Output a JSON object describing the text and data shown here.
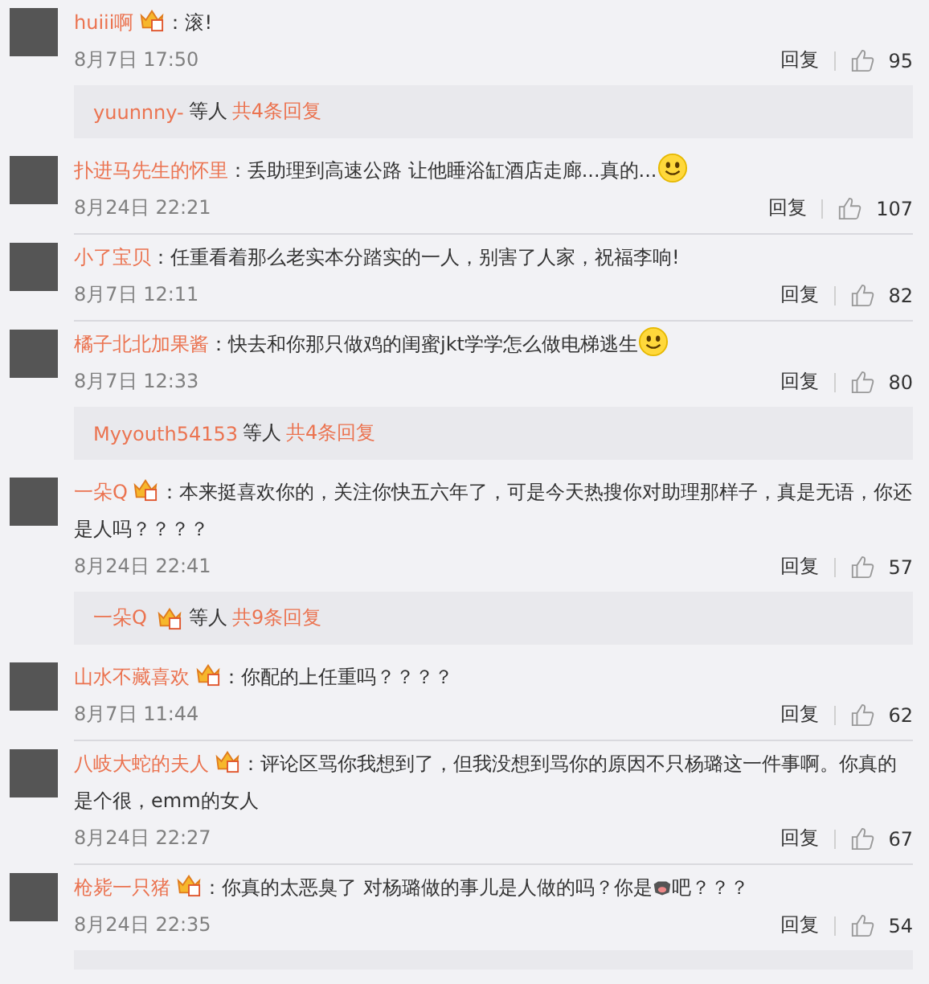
{
  "comments": [
    {
      "name": "huiii啊",
      "vip": true,
      "colon": "：",
      "parts": [
        {
          "kind": "text",
          "text": "滚!"
        }
      ],
      "date": "8月7日 17:50",
      "reply": "回复",
      "likes": "95",
      "thread": {
        "name": "yuunnny-",
        "vip": false,
        "suffix": "等人",
        "count": "共4条回复"
      }
    },
    {
      "name": "扑进马先生的怀里",
      "vip": false,
      "colon": "：",
      "parts": [
        {
          "kind": "text",
          "text": "丢助理到高速公路 让他睡浴缸酒店走廊...真的..."
        },
        {
          "kind": "smiley"
        }
      ],
      "date": "8月24日 22:21",
      "reply": "回复",
      "likes": "107"
    },
    {
      "name": "小了宝贝",
      "vip": false,
      "colon": "：",
      "parts": [
        {
          "kind": "text",
          "text": "任重看着那么老实本分踏实的一人，别害了人家，祝福李响!"
        }
      ],
      "date": "8月7日 12:11",
      "reply": "回复",
      "likes": "82"
    },
    {
      "name": "橘子北北加果酱",
      "vip": false,
      "colon": "：",
      "parts": [
        {
          "kind": "text",
          "text": "快去和你那只做鸡的闺蜜jkt学学怎么做电梯逃生"
        },
        {
          "kind": "smiley"
        }
      ],
      "date": "8月7日 12:33",
      "reply": "回复",
      "likes": "80",
      "thread": {
        "name": "Myyouth54153",
        "vip": false,
        "suffix": "等人",
        "count": "共4条回复"
      }
    },
    {
      "name": "一朵Q",
      "vip": true,
      "colon": "：",
      "parts": [
        {
          "kind": "text",
          "text": "本来挺喜欢你的，关注你快五六年了，可是今天热搜你对助理那样子，真是无语，你还是人吗？？？？"
        }
      ],
      "date": "8月24日 22:41",
      "reply": "回复",
      "likes": "57",
      "thread": {
        "name": "一朵Q",
        "vip": true,
        "suffix": "等人",
        "count": "共9条回复"
      }
    },
    {
      "name": "山水不藏喜欢",
      "vip": true,
      "colon": "：",
      "parts": [
        {
          "kind": "text",
          "text": "你配的上任重吗？？？？"
        }
      ],
      "date": "8月7日 11:44",
      "reply": "回复",
      "likes": "62"
    },
    {
      "name": "八岐大蛇的夫人",
      "vip": true,
      "colon": "：",
      "parts": [
        {
          "kind": "text",
          "text": "评论区骂你我想到了，但我没想到骂你的原因不只杨璐这一件事啊。你真的是个很，emm的女人"
        }
      ],
      "date": "8月24日 22:27",
      "reply": "回复",
      "likes": "67"
    },
    {
      "name": "枪毙一只猪",
      "vip": true,
      "colon": "：",
      "parts": [
        {
          "kind": "text",
          "text": "你真的太恶臭了  对杨璐做的事儿是人做的吗？你是"
        },
        {
          "kind": "pig"
        },
        {
          "kind": "text",
          "text": "吧？？？"
        }
      ],
      "date": "8月24日 22:35",
      "reply": "回复",
      "likes": "54",
      "replies_panel_edge": true
    }
  ]
}
